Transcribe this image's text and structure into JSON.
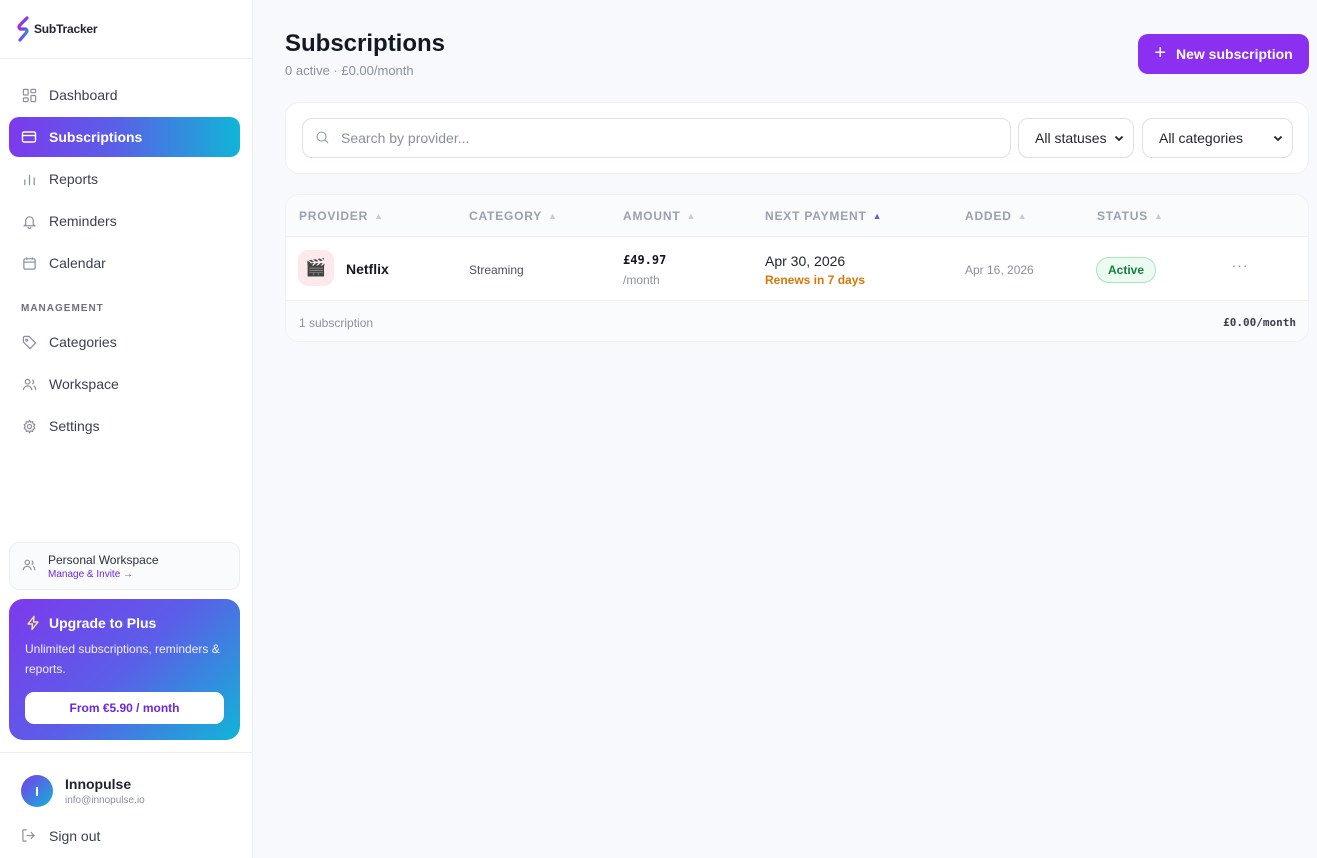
{
  "brand": {
    "name": "SubTracker"
  },
  "sidebar": {
    "items": [
      {
        "label": "Dashboard",
        "icon": "grid-icon"
      },
      {
        "label": "Subscriptions",
        "icon": "card-icon",
        "active": true
      },
      {
        "label": "Reports",
        "icon": "bar-chart-icon"
      },
      {
        "label": "Reminders",
        "icon": "bell-icon"
      },
      {
        "label": "Calendar",
        "icon": "calendar-icon"
      }
    ],
    "section_label": "MANAGEMENT",
    "management_items": [
      {
        "label": "Categories",
        "icon": "tag-icon"
      },
      {
        "label": "Workspace",
        "icon": "users-icon"
      },
      {
        "label": "Settings",
        "icon": "gear-icon"
      }
    ],
    "workspace": {
      "title": "Personal Workspace",
      "link": "Manage & Invite →"
    },
    "upgrade": {
      "title": "Upgrade to Plus",
      "description": "Unlimited subscriptions, reminders & reports.",
      "cta": "From €5.90 / month"
    },
    "user": {
      "initial": "I",
      "name": "Innopulse",
      "email": "info@innopulse.io"
    },
    "sign_out": "Sign out"
  },
  "header": {
    "title": "Subscriptions",
    "subtitle": "0 active · £0.00/month",
    "new_button": "New subscription"
  },
  "filters": {
    "search_placeholder": "Search by provider...",
    "status_select": "All statuses",
    "category_select": "All categories"
  },
  "table": {
    "columns": [
      "PROVIDER",
      "CATEGORY",
      "AMOUNT",
      "NEXT PAYMENT",
      "ADDED",
      "STATUS"
    ],
    "sorted_column": "NEXT PAYMENT",
    "rows": [
      {
        "icon": "🎬",
        "provider": "Netflix",
        "category": "Streaming",
        "amount": "£49.97",
        "amount_unit": "/month",
        "next_payment": "Apr 30, 2026",
        "renews": "Renews in 7 days",
        "added": "Apr 16, 2026",
        "status": "Active",
        "more": "···"
      }
    ],
    "footer_count": "1 subscription",
    "footer_total": "£0.00/month"
  },
  "colors": {
    "accent": "#8b2ff0",
    "gradient_start": "#7c3aed",
    "gradient_end": "#10b5d6",
    "status_active": "#15803d",
    "renew_warning": "#d97706"
  }
}
